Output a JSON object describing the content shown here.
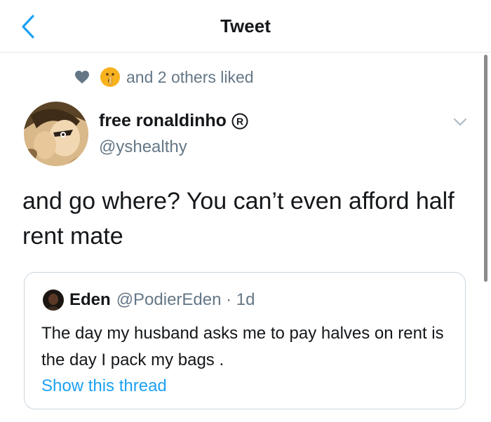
{
  "header": {
    "title": "Tweet",
    "back_icon": "chevron-left-icon"
  },
  "colors": {
    "accent": "#1da1f2",
    "secondary_text": "#657786",
    "primary_text": "#14171a",
    "border": "#e1e8ed"
  },
  "liked": {
    "heart_icon": "heart-icon",
    "emoji": "shushing-face-emoji",
    "text": "and 2 others liked"
  },
  "tweet": {
    "author_name": "free ronaldinho",
    "name_badge": "registered-icon",
    "handle": "@yshealthy",
    "text": "and go where? You can’t even afford half rent mate"
  },
  "quote": {
    "author_name": "Eden",
    "meta": "@PodierEden · 1d",
    "text": "The day my husband asks me to pay halves on rent is the day I pack my bags .",
    "link": "Show this thread"
  }
}
